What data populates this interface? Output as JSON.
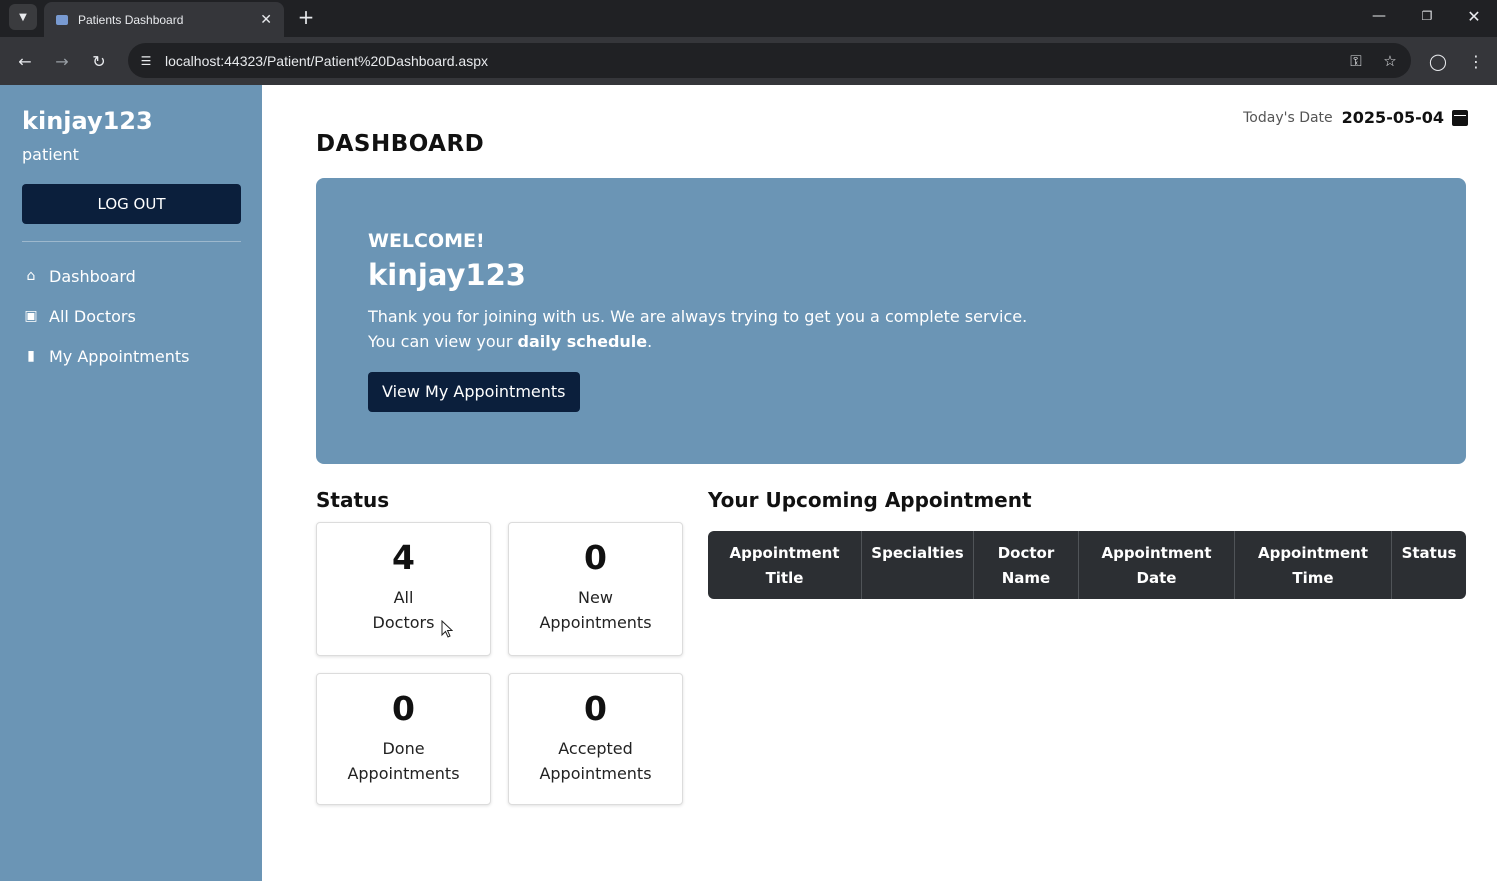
{
  "browser": {
    "tab_title": "Patients Dashboard",
    "url": "localhost:44323/Patient/Patient%20Dashboard.aspx",
    "icons": {
      "tab_menu": "chevron-down-icon",
      "new_tab": "plus-icon",
      "back": "arrow-left-icon",
      "forward": "arrow-right-icon",
      "reload": "reload-icon",
      "site_info": "tune-icon",
      "password": "key-icon",
      "bookmark": "star-icon",
      "profile": "profile-icon",
      "menu": "kebab-menu-icon"
    }
  },
  "sidebar": {
    "username": "kinjay123",
    "role": "patient",
    "logout_label": "LOG OUT",
    "items": [
      {
        "label": "Dashboard",
        "icon": "home-icon"
      },
      {
        "label": "All Doctors",
        "icon": "briefcase-icon"
      },
      {
        "label": "My Appointments",
        "icon": "bookmark-icon"
      }
    ]
  },
  "header": {
    "date_label": "Today's Date",
    "date_value": "2025-05-04",
    "page_title": "DASHBOARD"
  },
  "welcome": {
    "label": "WELCOME!",
    "name": "kinjay123",
    "line1": "Thank you for joining with us. We are always trying to get you a complete service.",
    "line2_prefix": "You can view your ",
    "line2_bold": "daily schedule",
    "line2_suffix": ".",
    "button_label": "View My Appointments"
  },
  "status": {
    "title": "Status",
    "cards": [
      {
        "value": "4",
        "label": "All Doctors"
      },
      {
        "value": "0",
        "label": "New Appointments"
      },
      {
        "value": "0",
        "label": "Done Appointments"
      },
      {
        "value": "0",
        "label": "Accepted Appointments"
      }
    ]
  },
  "upcoming": {
    "title": "Your Upcoming Appointment",
    "columns": [
      "Appointment Title",
      "Specialties",
      "Doctor Name",
      "Appointment Date",
      "Appointment Time",
      "Status"
    ]
  },
  "colors": {
    "sidebar_bg": "#6b95b5",
    "welcome_bg": "#6b95b5",
    "dark_button": "#0b1f3c",
    "table_header": "#2c2f33"
  }
}
